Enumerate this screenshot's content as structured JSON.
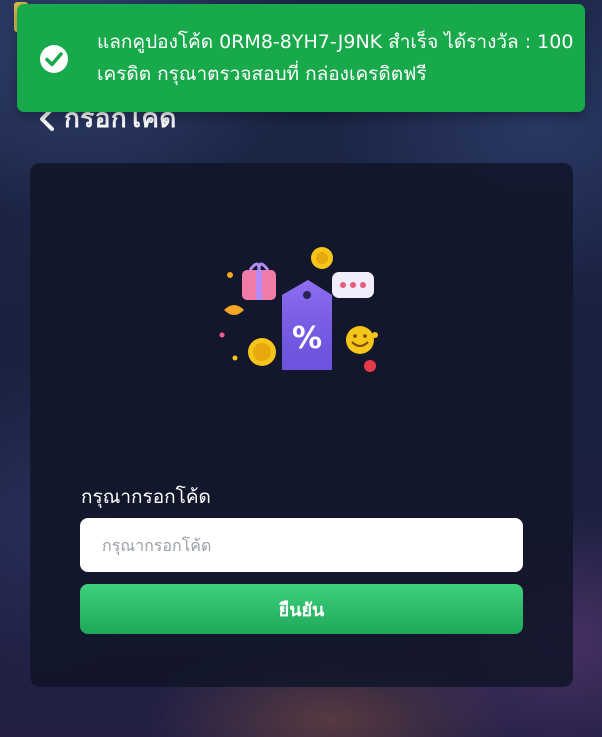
{
  "toast": {
    "message": "แลกคูปองโค้ด 0RM8-8YH7-J9NK สำเร็จ ได้รางวัล : 100 เครดิต กรุณาตรวจสอบที่ กล่องเครดิตฟรี",
    "icon": "check-circle-icon",
    "color": "#17a94a"
  },
  "header": {
    "back_icon": "chevron-left-icon",
    "title": "กรอกโค้ด"
  },
  "form": {
    "illustration": "coupon-discount-illustration",
    "label": "กรุณากรอกโค้ด",
    "input_placeholder": "กรุณากรอกโค้ด",
    "input_value": "",
    "submit_label": "ยืนยัน",
    "accent": "#2fbe6b"
  }
}
